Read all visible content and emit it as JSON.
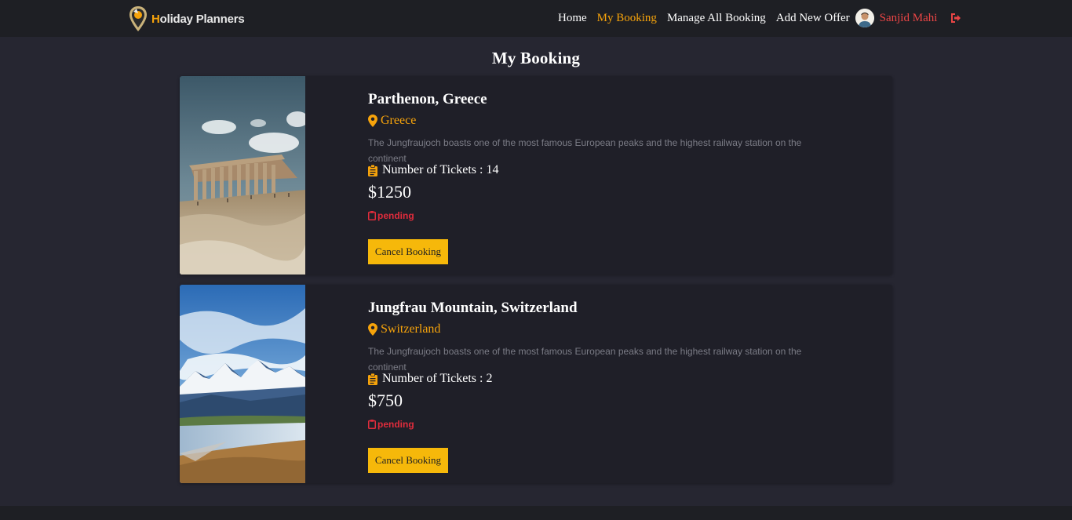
{
  "brand": {
    "name_first": "H",
    "name_rest": "oliday Planners"
  },
  "nav": {
    "items": [
      {
        "label": "Home",
        "active": false
      },
      {
        "label": "My Booking",
        "active": true
      },
      {
        "label": "Manage All Booking",
        "active": false
      },
      {
        "label": "Add New Offer",
        "active": false
      }
    ],
    "user_name": "Sanjid Mahi",
    "logout_icon": "sign-out-icon"
  },
  "page": {
    "title": "My Booking"
  },
  "bookings": [
    {
      "title": "Parthenon, Greece",
      "location": "Greece",
      "description": "The Jungfraujoch boasts one of the most famous European peaks and the highest railway station on the continent",
      "tickets_text": "Number of Tickets : 14",
      "price": "$1250",
      "status": "pending",
      "cancel_label": "Cancel Booking"
    },
    {
      "title": "Jungfrau Mountain, Switzerland",
      "location": "Switzerland",
      "description": "The Jungfraujoch boasts one of the most famous European peaks and the highest railway station on the continent",
      "tickets_text": "Number of Tickets : 2",
      "price": "$750",
      "status": "pending",
      "cancel_label": "Cancel Booking"
    }
  ],
  "colors": {
    "accent": "#f6a30b",
    "button": "#f6b80a",
    "status": "#e02c3c",
    "user": "#e94545",
    "background": "#262631",
    "card": "#1f1f28"
  }
}
